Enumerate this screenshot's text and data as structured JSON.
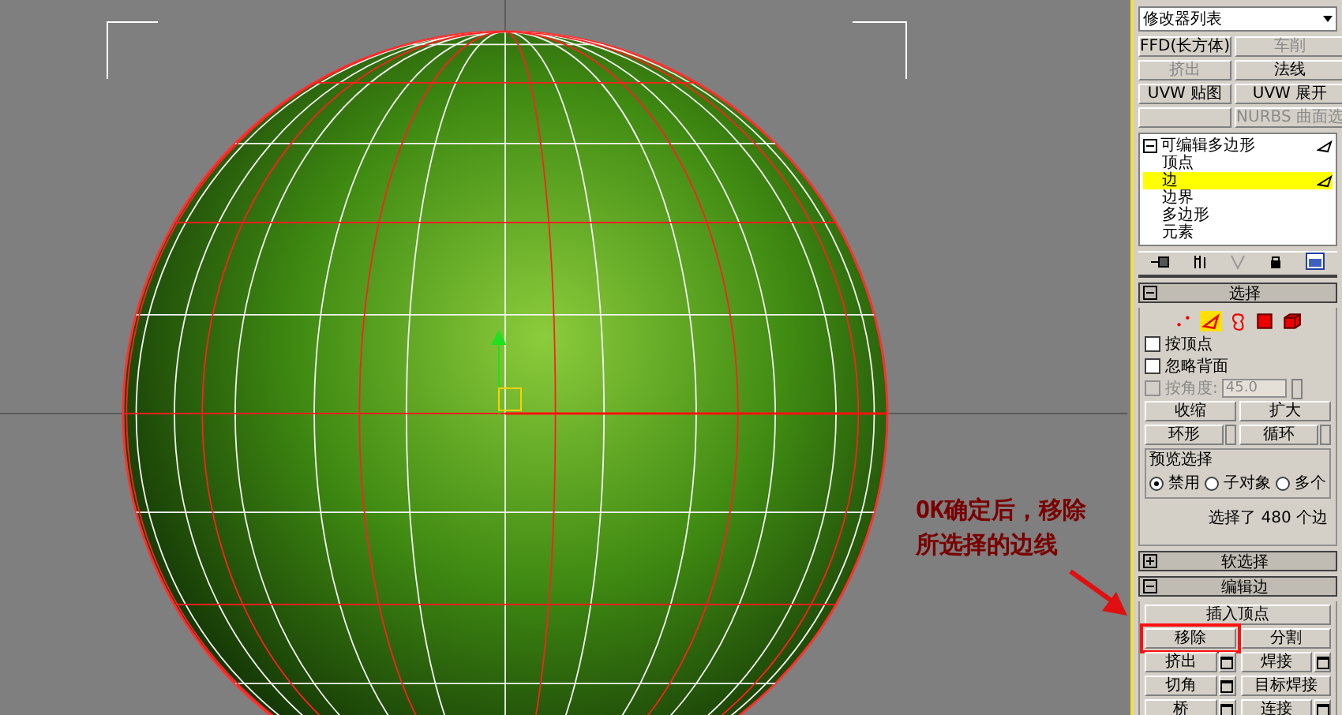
{
  "annotation": {
    "lines": [
      "OK确定后，移除",
      "所选择的边线"
    ]
  },
  "modifier_list": {
    "value": "修改器列表"
  },
  "modifier_buttons": [
    {
      "kind": "button",
      "label": "FFD(长方体)",
      "disabled": false
    },
    {
      "kind": "button",
      "label": "车削",
      "disabled": true
    },
    {
      "kind": "button",
      "label": "挤出",
      "disabled": true
    },
    {
      "kind": "button",
      "label": "法线",
      "disabled": false
    },
    {
      "kind": "button",
      "label": "UVW 贴图",
      "disabled": false
    },
    {
      "kind": "button",
      "label": "UVW 展开",
      "disabled": false
    },
    {
      "kind": "blank"
    },
    {
      "kind": "button",
      "label": "NURBS 曲面选",
      "disabled": true
    }
  ],
  "stack": {
    "title": "可编辑多边形",
    "expanded": true,
    "children": [
      {
        "label": "顶点",
        "selected": false
      },
      {
        "label": "边",
        "selected": true
      },
      {
        "label": "边界",
        "selected": false
      },
      {
        "label": "多边形",
        "selected": false
      },
      {
        "label": "元素",
        "selected": false
      }
    ]
  },
  "selection": {
    "title": "选择",
    "expanded": true,
    "subobjects": [
      {
        "kind": "vertex",
        "selected": false
      },
      {
        "kind": "edge",
        "selected": true
      },
      {
        "kind": "border",
        "selected": false
      },
      {
        "kind": "polygon",
        "selected": false
      },
      {
        "kind": "element",
        "selected": false
      }
    ],
    "checkboxes": [
      {
        "label": "按顶点",
        "checked": false,
        "disabled": false
      },
      {
        "label": "忽略背面",
        "checked": false,
        "disabled": false
      },
      {
        "label": "按角度:",
        "checked": false,
        "disabled": true,
        "value": "45.0"
      }
    ],
    "buttons": [
      {
        "label": "收缩",
        "spinner": false
      },
      {
        "label": "扩大",
        "spinner": false
      },
      {
        "label": "环形",
        "spinner": true
      },
      {
        "label": "循环",
        "spinner": true
      }
    ],
    "preview": {
      "title": "预览选择",
      "options": [
        {
          "label": "禁用",
          "selected": true
        },
        {
          "label": "子对象",
          "selected": false
        },
        {
          "label": "多个",
          "selected": false
        }
      ]
    },
    "status": "选择了 480 个边"
  },
  "rollouts": [
    {
      "title": "软选择",
      "expanded": false
    },
    {
      "title": "编辑边",
      "expanded": true
    }
  ],
  "edit_edges": [
    [
      {
        "label": "插入顶点",
        "settings": false,
        "highlighted": false
      }
    ],
    [
      {
        "label": "移除",
        "settings": false,
        "highlighted": true
      },
      {
        "label": "分割",
        "settings": false,
        "highlighted": false
      }
    ],
    [
      {
        "label": "挤出",
        "settings": true,
        "highlighted": false
      },
      {
        "label": "焊接",
        "settings": true,
        "highlighted": false
      }
    ],
    [
      {
        "label": "切角",
        "settings": true,
        "highlighted": false
      },
      {
        "label": "目标焊接",
        "settings": false,
        "highlighted": false
      }
    ],
    [
      {
        "label": "桥",
        "settings": true,
        "highlighted": false
      },
      {
        "label": "连接",
        "settings": true,
        "highlighted": false
      }
    ]
  ]
}
